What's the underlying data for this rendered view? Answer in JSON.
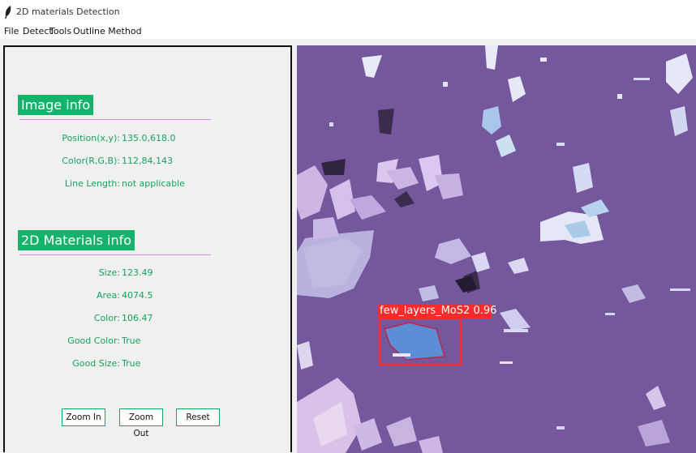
{
  "window": {
    "title": "2D materials Detection"
  },
  "menu": [
    "File",
    "Detect",
    "Tools",
    "Outline Method"
  ],
  "image_info": {
    "title": "Image info",
    "rows": [
      {
        "label": "Position(x,y):",
        "value": "135.0,618.0"
      },
      {
        "label": "Color(R,G,B):",
        "value": "112,84,143"
      },
      {
        "label": "Line Length:",
        "value": "not  applicable"
      }
    ]
  },
  "materials_info": {
    "title": "2D Materials info",
    "rows": [
      {
        "label": "Size:",
        "value": "123.49"
      },
      {
        "label": "Area:",
        "value": "4074.5"
      },
      {
        "label": "Color:",
        "value": "106.47"
      },
      {
        "label": "Good Color:",
        "value": "True"
      },
      {
        "label": "Good Size:",
        "value": "True"
      }
    ]
  },
  "buttons": {
    "zoom_in": "Zoom In",
    "zoom_out": "Zoom Out",
    "reset": "Reset"
  },
  "detection": {
    "label": "few_layers_MoS2",
    "score": "0.96",
    "box_color": "#ff2a2a"
  },
  "colors": {
    "accent": "#13b36b",
    "text_green": "#16a35d",
    "rule": "#d38ce8",
    "substrate": "#75579e"
  }
}
